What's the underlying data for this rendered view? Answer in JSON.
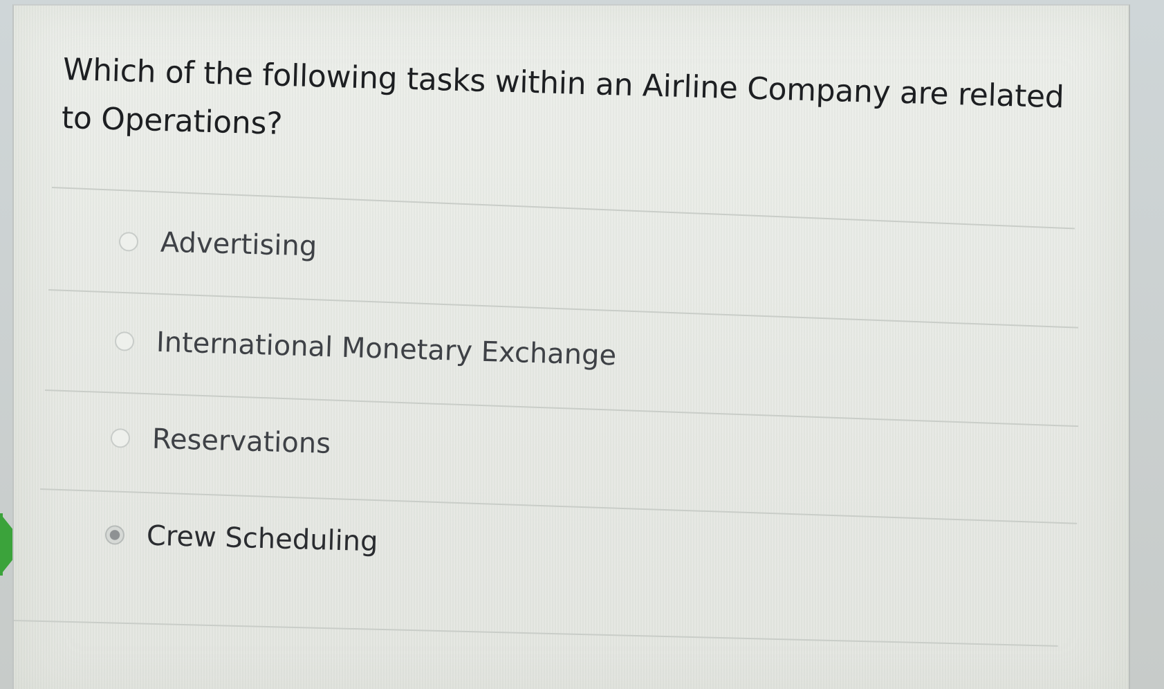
{
  "question": {
    "text": "Which of the following tasks within an Airline Company are related to Operations?"
  },
  "options": [
    {
      "label": "Advertising",
      "selected": false
    },
    {
      "label": "International Monetary Exchange",
      "selected": false
    },
    {
      "label": "Reservations",
      "selected": false
    },
    {
      "label": "Crew Scheduling",
      "selected": true
    }
  ],
  "colors": {
    "correct_marker": "#3ba33b",
    "question_text": "#1d1f22",
    "option_text": "#3e4146"
  }
}
